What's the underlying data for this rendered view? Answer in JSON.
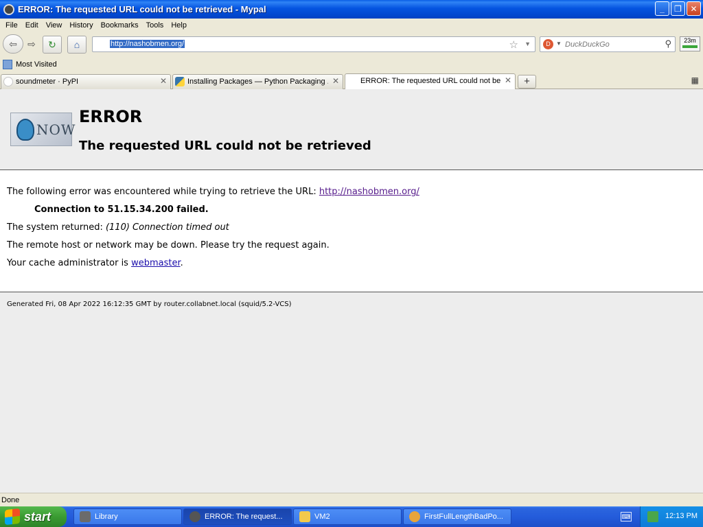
{
  "window": {
    "title": "ERROR: The requested URL could not be retrieved - Mypal",
    "minimize_glyph": "_",
    "maximize_glyph": "❐",
    "close_glyph": "✕"
  },
  "menubar": {
    "items": [
      "File",
      "Edit",
      "View",
      "History",
      "Bookmarks",
      "Tools",
      "Help"
    ]
  },
  "navbar": {
    "back_glyph": "⇦",
    "forward_glyph": "⇨",
    "reload_glyph": "↻",
    "home_glyph": "⌂",
    "url": "http://nashobmen.org/",
    "star_glyph": "☆",
    "dropdown_glyph": "▼",
    "search_engine_glyph": "D",
    "search_placeholder": "DuckDuckGo",
    "search_glyph": "⚲",
    "addon_label": "23m"
  },
  "bookmarks_toolbar": {
    "items": [
      "Most Visited"
    ]
  },
  "tabs": [
    {
      "label": "soundmeter · PyPI",
      "active": false
    },
    {
      "label": "Installing Packages — Python Packaging ...",
      "active": false
    },
    {
      "label": "ERROR: The requested URL could not be...",
      "active": true
    }
  ],
  "tab_controls": {
    "close_glyph": "✕",
    "new_tab_glyph": "+",
    "tab_list_glyph": "▦"
  },
  "page": {
    "logo_text": "NOW",
    "heading": "ERROR",
    "subheading": "The requested URL could not be retrieved",
    "intro": "The following error was encountered while trying to retrieve the URL: ",
    "url_link": "http://nashobmen.org/",
    "connection_failed": "Connection to 51.15.34.200 failed.",
    "system_returned_prefix": "The system returned: ",
    "system_returned_value": "(110) Connection timed out",
    "remote_host": "The remote host or network may be down. Please try the request again.",
    "cache_admin_prefix": "Your cache administrator is ",
    "cache_admin_link": "webmaster",
    "cache_admin_suffix": ".",
    "generated": "Generated Fri, 08 Apr 2022 16:12:35 GMT by router.collabnet.local (squid/5.2-VCS)"
  },
  "statusbar": {
    "text": "Done"
  },
  "taskbar": {
    "start_label": "start",
    "tasks": [
      {
        "label": "Library",
        "icon_color": "#6b6b6b"
      },
      {
        "label": "ERROR: The request...",
        "icon_color": "#555555"
      },
      {
        "label": "VM2",
        "icon_color": "#f2c94c"
      },
      {
        "label": "FirstFullLengthBadPo...",
        "icon_color": "#e8a43a"
      }
    ],
    "keyboard_glyph": "⌨",
    "clock": "12:13 PM"
  }
}
